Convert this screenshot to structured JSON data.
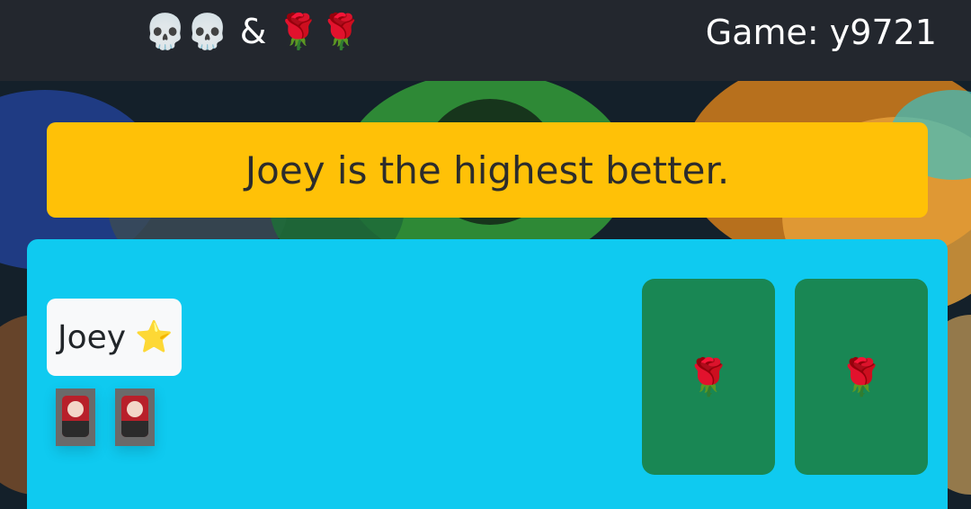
{
  "header": {
    "title": "💀💀 & 🌹🌹",
    "game_label": "Game: y9721"
  },
  "status": {
    "message": "Joey is the highest better."
  },
  "player": {
    "name": "Joey",
    "badge_icon": "⭐",
    "chips": [
      {
        "icon": "coaster-chip-icon"
      },
      {
        "icon": "coaster-chip-icon"
      }
    ],
    "cards": [
      {
        "face": "🌹"
      },
      {
        "face": "🌹"
      }
    ]
  },
  "colors": {
    "navbar": "#23272e",
    "alert": "#ffc107",
    "panel": "#0fcaf0",
    "card": "#198754"
  }
}
